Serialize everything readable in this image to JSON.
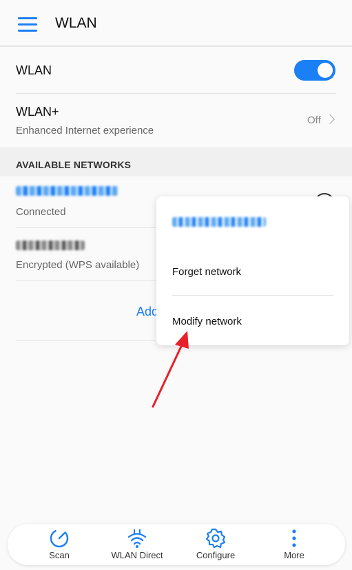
{
  "header": {
    "title": "WLAN"
  },
  "wlan": {
    "label": "WLAN",
    "enabled": true
  },
  "wlan_plus": {
    "title": "WLAN+",
    "subtitle": "Enhanced Internet experience",
    "value": "Off"
  },
  "section": {
    "title": "AVAILABLE NETWORKS"
  },
  "networks": [
    {
      "status": "Connected"
    },
    {
      "status": "Encrypted (WPS available)"
    }
  ],
  "add_network": {
    "label": "Add"
  },
  "popup": {
    "items": [
      "Forget network",
      "Modify network"
    ]
  },
  "bottom_nav": [
    {
      "label": "Scan",
      "icon": "scan-icon"
    },
    {
      "label": "WLAN Direct",
      "icon": "wlan-direct-icon"
    },
    {
      "label": "Configure",
      "icon": "gear-icon"
    },
    {
      "label": "More",
      "icon": "more-vertical-icon"
    }
  ],
  "colors": {
    "accent": "#1b7ff5",
    "annotation_arrow": "#e8202a"
  }
}
